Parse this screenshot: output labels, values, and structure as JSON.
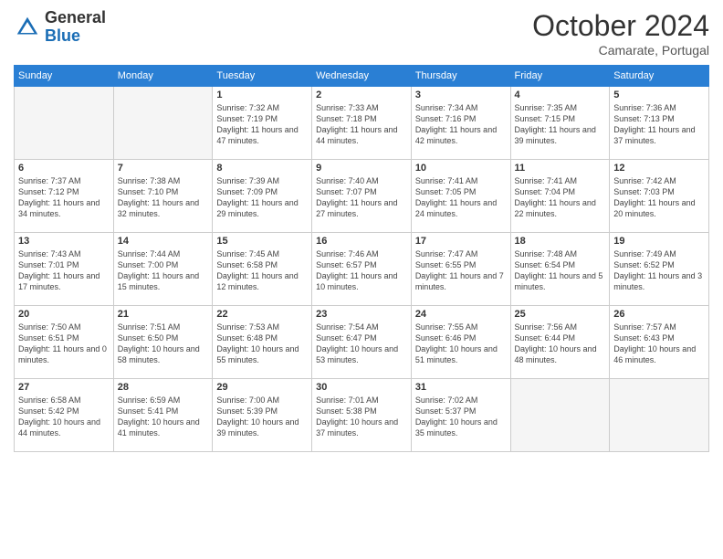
{
  "header": {
    "logo_general": "General",
    "logo_blue": "Blue",
    "month": "October 2024",
    "location": "Camarate, Portugal"
  },
  "days_of_week": [
    "Sunday",
    "Monday",
    "Tuesday",
    "Wednesday",
    "Thursday",
    "Friday",
    "Saturday"
  ],
  "weeks": [
    [
      {
        "day": "",
        "info": ""
      },
      {
        "day": "",
        "info": ""
      },
      {
        "day": "1",
        "info": "Sunrise: 7:32 AM\nSunset: 7:19 PM\nDaylight: 11 hours and 47 minutes."
      },
      {
        "day": "2",
        "info": "Sunrise: 7:33 AM\nSunset: 7:18 PM\nDaylight: 11 hours and 44 minutes."
      },
      {
        "day": "3",
        "info": "Sunrise: 7:34 AM\nSunset: 7:16 PM\nDaylight: 11 hours and 42 minutes."
      },
      {
        "day": "4",
        "info": "Sunrise: 7:35 AM\nSunset: 7:15 PM\nDaylight: 11 hours and 39 minutes."
      },
      {
        "day": "5",
        "info": "Sunrise: 7:36 AM\nSunset: 7:13 PM\nDaylight: 11 hours and 37 minutes."
      }
    ],
    [
      {
        "day": "6",
        "info": "Sunrise: 7:37 AM\nSunset: 7:12 PM\nDaylight: 11 hours and 34 minutes."
      },
      {
        "day": "7",
        "info": "Sunrise: 7:38 AM\nSunset: 7:10 PM\nDaylight: 11 hours and 32 minutes."
      },
      {
        "day": "8",
        "info": "Sunrise: 7:39 AM\nSunset: 7:09 PM\nDaylight: 11 hours and 29 minutes."
      },
      {
        "day": "9",
        "info": "Sunrise: 7:40 AM\nSunset: 7:07 PM\nDaylight: 11 hours and 27 minutes."
      },
      {
        "day": "10",
        "info": "Sunrise: 7:41 AM\nSunset: 7:05 PM\nDaylight: 11 hours and 24 minutes."
      },
      {
        "day": "11",
        "info": "Sunrise: 7:41 AM\nSunset: 7:04 PM\nDaylight: 11 hours and 22 minutes."
      },
      {
        "day": "12",
        "info": "Sunrise: 7:42 AM\nSunset: 7:03 PM\nDaylight: 11 hours and 20 minutes."
      }
    ],
    [
      {
        "day": "13",
        "info": "Sunrise: 7:43 AM\nSunset: 7:01 PM\nDaylight: 11 hours and 17 minutes."
      },
      {
        "day": "14",
        "info": "Sunrise: 7:44 AM\nSunset: 7:00 PM\nDaylight: 11 hours and 15 minutes."
      },
      {
        "day": "15",
        "info": "Sunrise: 7:45 AM\nSunset: 6:58 PM\nDaylight: 11 hours and 12 minutes."
      },
      {
        "day": "16",
        "info": "Sunrise: 7:46 AM\nSunset: 6:57 PM\nDaylight: 11 hours and 10 minutes."
      },
      {
        "day": "17",
        "info": "Sunrise: 7:47 AM\nSunset: 6:55 PM\nDaylight: 11 hours and 7 minutes."
      },
      {
        "day": "18",
        "info": "Sunrise: 7:48 AM\nSunset: 6:54 PM\nDaylight: 11 hours and 5 minutes."
      },
      {
        "day": "19",
        "info": "Sunrise: 7:49 AM\nSunset: 6:52 PM\nDaylight: 11 hours and 3 minutes."
      }
    ],
    [
      {
        "day": "20",
        "info": "Sunrise: 7:50 AM\nSunset: 6:51 PM\nDaylight: 11 hours and 0 minutes."
      },
      {
        "day": "21",
        "info": "Sunrise: 7:51 AM\nSunset: 6:50 PM\nDaylight: 10 hours and 58 minutes."
      },
      {
        "day": "22",
        "info": "Sunrise: 7:53 AM\nSunset: 6:48 PM\nDaylight: 10 hours and 55 minutes."
      },
      {
        "day": "23",
        "info": "Sunrise: 7:54 AM\nSunset: 6:47 PM\nDaylight: 10 hours and 53 minutes."
      },
      {
        "day": "24",
        "info": "Sunrise: 7:55 AM\nSunset: 6:46 PM\nDaylight: 10 hours and 51 minutes."
      },
      {
        "day": "25",
        "info": "Sunrise: 7:56 AM\nSunset: 6:44 PM\nDaylight: 10 hours and 48 minutes."
      },
      {
        "day": "26",
        "info": "Sunrise: 7:57 AM\nSunset: 6:43 PM\nDaylight: 10 hours and 46 minutes."
      }
    ],
    [
      {
        "day": "27",
        "info": "Sunrise: 6:58 AM\nSunset: 5:42 PM\nDaylight: 10 hours and 44 minutes."
      },
      {
        "day": "28",
        "info": "Sunrise: 6:59 AM\nSunset: 5:41 PM\nDaylight: 10 hours and 41 minutes."
      },
      {
        "day": "29",
        "info": "Sunrise: 7:00 AM\nSunset: 5:39 PM\nDaylight: 10 hours and 39 minutes."
      },
      {
        "day": "30",
        "info": "Sunrise: 7:01 AM\nSunset: 5:38 PM\nDaylight: 10 hours and 37 minutes."
      },
      {
        "day": "31",
        "info": "Sunrise: 7:02 AM\nSunset: 5:37 PM\nDaylight: 10 hours and 35 minutes."
      },
      {
        "day": "",
        "info": ""
      },
      {
        "day": "",
        "info": ""
      }
    ]
  ]
}
